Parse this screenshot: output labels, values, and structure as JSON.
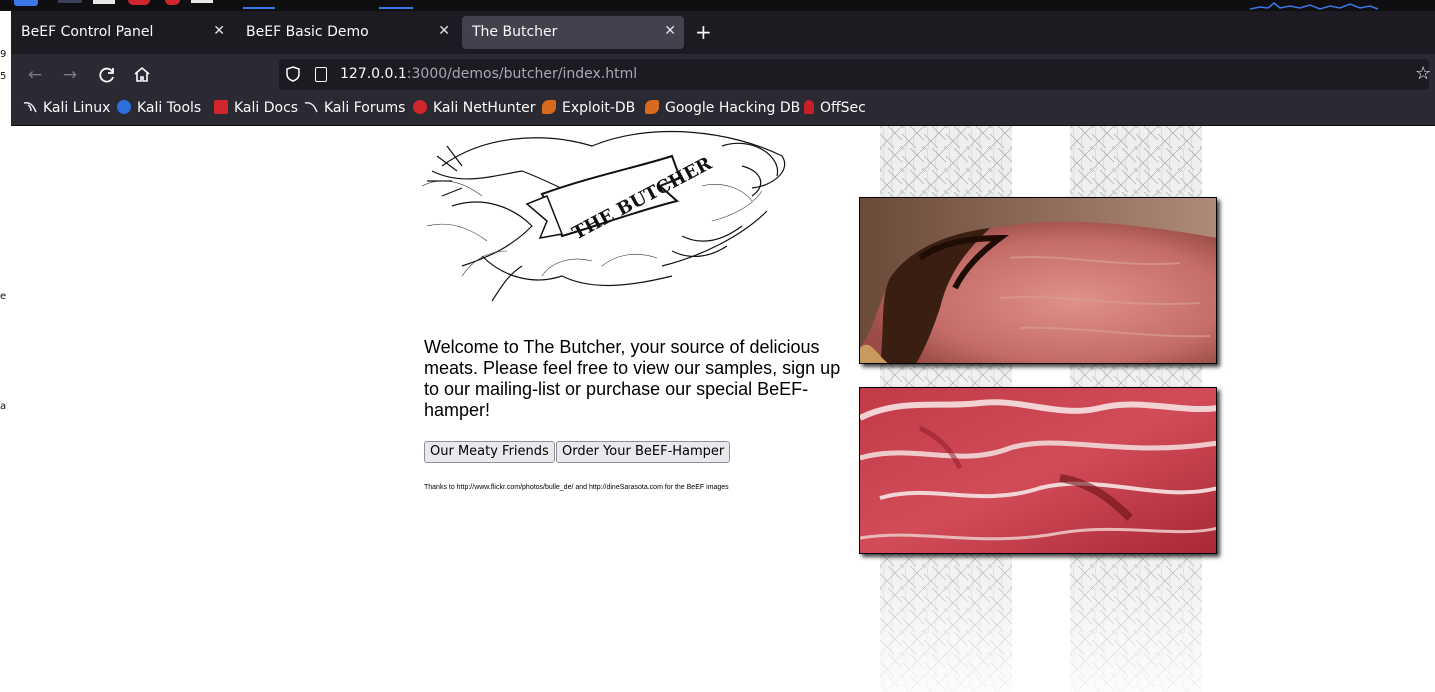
{
  "tabs": [
    {
      "label": "BeEF Control Panel",
      "active": false
    },
    {
      "label": "BeEF Basic Demo",
      "active": false
    },
    {
      "label": "The Butcher",
      "active": true
    }
  ],
  "nav": {
    "url_host": "127.0.0.1",
    "url_rest": ":3000/demos/butcher/index.html"
  },
  "bookmarks": [
    {
      "label": "Kali Linux",
      "icon": "kali-dragon-icon"
    },
    {
      "label": "Kali Tools",
      "icon": "kali-tools-icon"
    },
    {
      "label": "Kali Docs",
      "icon": "kali-docs-icon"
    },
    {
      "label": "Kali Forums",
      "icon": "kali-forums-icon"
    },
    {
      "label": "Kali NetHunter",
      "icon": "nethunter-icon"
    },
    {
      "label": "Exploit-DB",
      "icon": "exploit-db-icon"
    },
    {
      "label": "Google Hacking DB",
      "icon": "ghdb-icon"
    },
    {
      "label": "OffSec",
      "icon": "offsec-icon"
    }
  ],
  "page": {
    "logo_text": "THE BUTCHER",
    "welcome_text": "Welcome to The Butcher, your source of delicious meats. Please feel free to view our samples, sign up to our mailing-list or purchase our special BeEF-hamper!",
    "button_friends": "Our Meaty Friends",
    "button_order": "Order Your BeEF-Hamper",
    "thanks_text": "Thanks to http://www.flickr.com/photos/bulle_de/ and http://dineSarasota.com for the BeEF images"
  },
  "colors": {
    "chrome_dark": "#1c1b22",
    "chrome_mid": "#2b2a33",
    "tab_active": "#42414d",
    "taskbar_accent": "#3a77e8"
  }
}
